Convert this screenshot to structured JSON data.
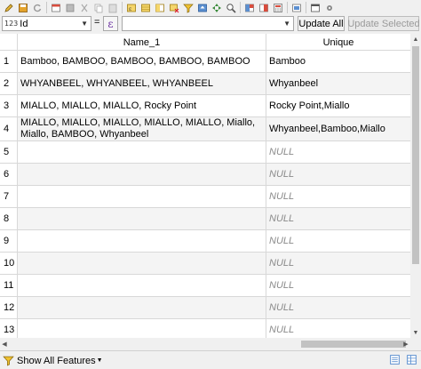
{
  "toolbar": {
    "icons": [
      "pencil-icon",
      "save-icon",
      "reload-icon",
      "add-feature-icon",
      "delete-icon",
      "cut-icon",
      "copy-icon",
      "paste-icon",
      "select-expression-icon",
      "select-all-icon",
      "invert-selection-icon",
      "deselect-icon",
      "filter-icon",
      "move-top-icon",
      "pan-icon",
      "zoom-icon",
      "new-field-icon",
      "delete-field-icon",
      "field-calculator-icon",
      "conditional-format-icon",
      "dock-icon",
      "actions-icon"
    ]
  },
  "calc": {
    "field_type": "123",
    "field_value": "Id",
    "equals": "=",
    "epsilon": "ε",
    "update_all": "Update All",
    "update_selected": "Update Selected"
  },
  "table": {
    "columns": [
      "Name_1",
      "Unique"
    ],
    "rows": [
      {
        "n": "1",
        "name": "Bamboo, BAMBOO, BAMBOO, BAMBOO, BAMBOO",
        "unique": "Bamboo"
      },
      {
        "n": "2",
        "name": "WHYANBEEL, WHYANBEEL, WHYANBEEL",
        "unique": "Whyanbeel"
      },
      {
        "n": "3",
        "name": "MIALLO, MIALLO, MIALLO, Rocky Point",
        "unique": "Rocky Point,Miallo"
      },
      {
        "n": "4",
        "name": "MIALLO, MIALLO, MIALLO, MIALLO, MIALLO, Miallo, Miallo, BAMBOO, Whyanbeel",
        "unique": "Whyanbeel,Bamboo,Miallo"
      },
      {
        "n": "5",
        "name": "",
        "unique": "NULL"
      },
      {
        "n": "6",
        "name": "",
        "unique": "NULL"
      },
      {
        "n": "7",
        "name": "",
        "unique": "NULL"
      },
      {
        "n": "8",
        "name": "",
        "unique": "NULL"
      },
      {
        "n": "9",
        "name": "",
        "unique": "NULL"
      },
      {
        "n": "10",
        "name": "",
        "unique": "NULL"
      },
      {
        "n": "11",
        "name": "",
        "unique": "NULL"
      },
      {
        "n": "12",
        "name": "",
        "unique": "NULL"
      },
      {
        "n": "13",
        "name": "",
        "unique": "NULL"
      }
    ]
  },
  "footer": {
    "show_features": "Show All Features"
  }
}
